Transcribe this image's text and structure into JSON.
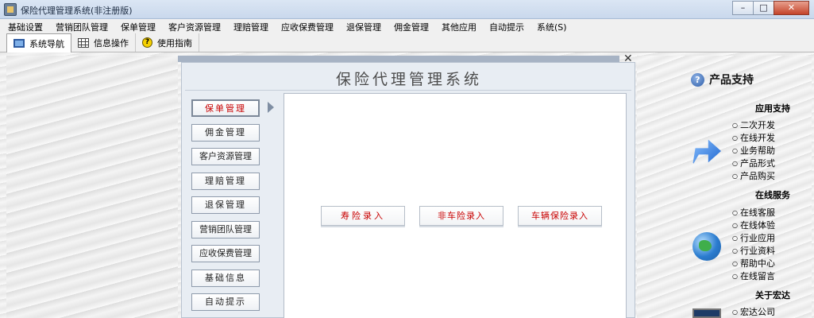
{
  "window": {
    "title": "保险代理管理系统(非注册版)",
    "controls": {
      "minimize": "–",
      "maximize": "□",
      "close": "✕"
    }
  },
  "menu": [
    "基础设置",
    "营销团队管理",
    "保单管理",
    "客户资源管理",
    "理赔管理",
    "应收保费管理",
    "退保管理",
    "佣金管理",
    "其他应用",
    "自动提示",
    "系统(S)"
  ],
  "tabs": [
    {
      "label": "系统导航",
      "icon": "monitor-icon",
      "active": true
    },
    {
      "label": "信息操作",
      "icon": "grid-icon",
      "active": false
    },
    {
      "label": "使用指南",
      "icon": "help-icon",
      "active": false
    }
  ],
  "center": {
    "title": "保险代理管理系统",
    "close": "✕",
    "nav": [
      {
        "label": "保单管理",
        "active": true
      },
      {
        "label": "佣金管理",
        "active": false
      },
      {
        "label": "客户资源管理",
        "active": false
      },
      {
        "label": "理赔管理",
        "active": false
      },
      {
        "label": "退保管理",
        "active": false
      },
      {
        "label": "营销团队管理",
        "active": false
      },
      {
        "label": "应收保费管理",
        "active": false
      },
      {
        "label": "基础信息",
        "active": false
      },
      {
        "label": "自动提示",
        "active": false
      }
    ],
    "entries": [
      "寿险录入",
      "非车险录入",
      "车辆保险录入"
    ]
  },
  "support": {
    "title": "产品支持",
    "sections": [
      {
        "heading": "应用支持",
        "icon": "arrow-icon",
        "links": [
          "二次开发",
          "在线开发",
          "业务帮助",
          "产品形式",
          "产品购买"
        ]
      },
      {
        "heading": "在线服务",
        "icon": "globe-icon",
        "links": [
          "在线客服",
          "在线体验",
          "行业应用",
          "行业资料",
          "帮助中心",
          "在线留言"
        ]
      },
      {
        "heading": "关于宏达",
        "icon": "laptop-icon",
        "links": [
          "宏达公司"
        ]
      }
    ]
  },
  "colors": {
    "active_text": "#c80000",
    "title_bar": "#dbe6f4",
    "close_button": "#c4442a"
  }
}
